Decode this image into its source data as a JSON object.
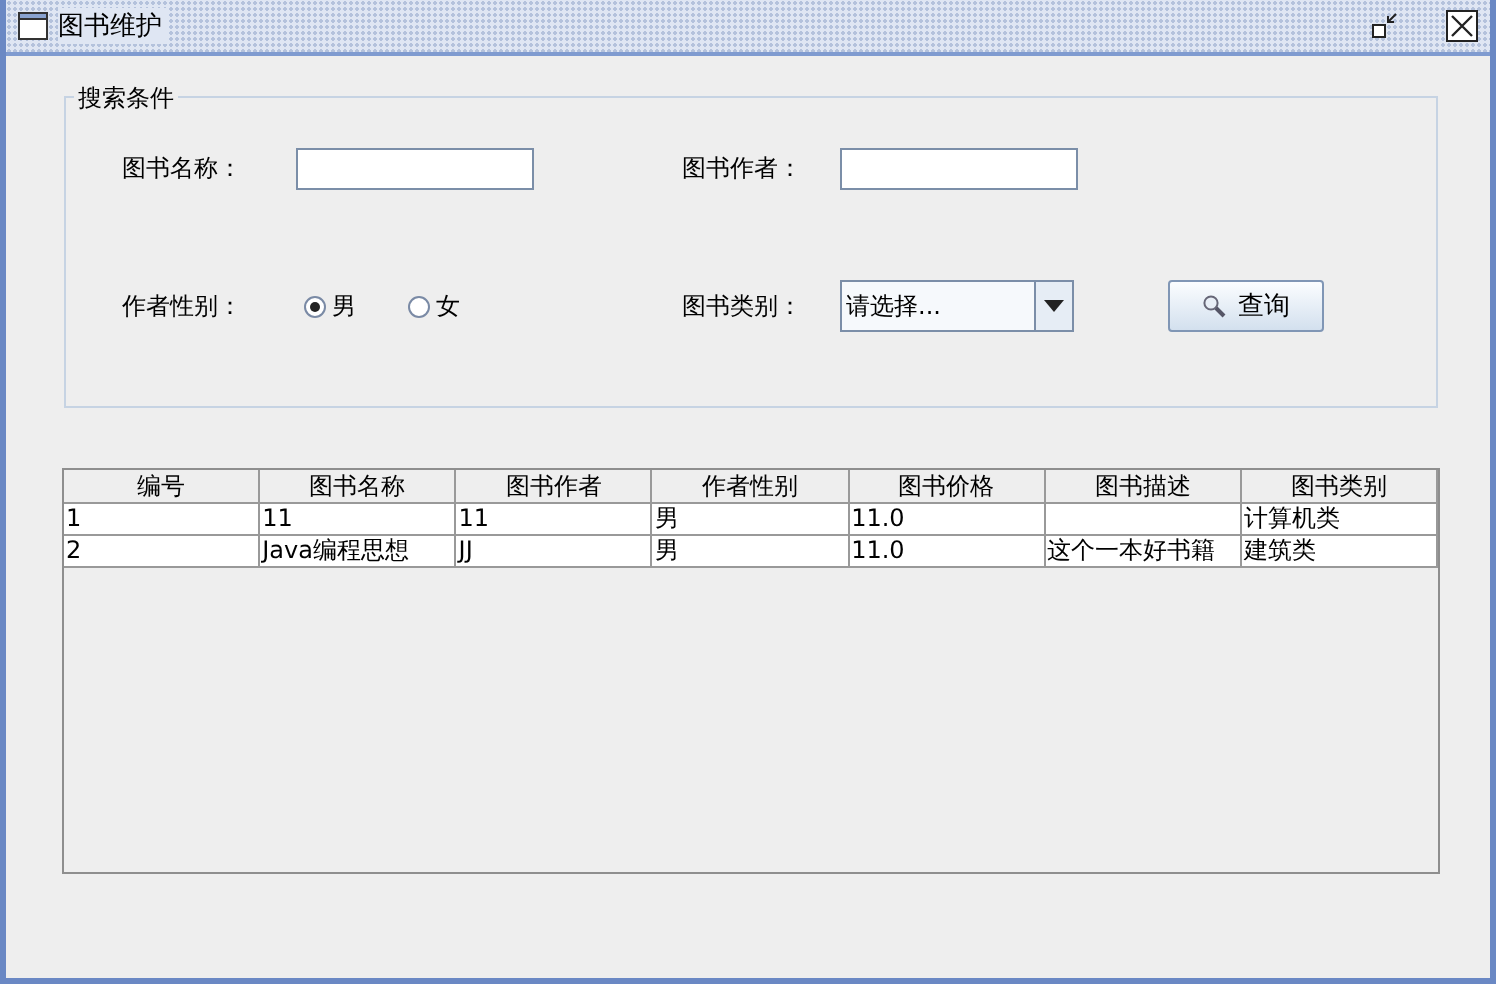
{
  "window": {
    "title": "图书维护"
  },
  "search": {
    "legend": "搜索条件",
    "name_field": {
      "label": "图书名称："
    },
    "author_field": {
      "label": "图书作者："
    },
    "gender": {
      "label": "作者性别：",
      "options": [
        {
          "label": "男",
          "selected": true
        },
        {
          "label": "女",
          "selected": false
        }
      ]
    },
    "category": {
      "label": "图书类别：",
      "value": "请选择..."
    },
    "button": {
      "label": "查询"
    }
  },
  "table": {
    "columns": [
      "编号",
      "图书名称",
      "图书作者",
      "作者性别",
      "图书价格",
      "图书描述",
      "图书类别"
    ],
    "rows": [
      [
        "1",
        "11",
        "11",
        "男",
        "11.0",
        null,
        "计算机类"
      ],
      [
        "2",
        "Java编程思想",
        "JJ",
        "男",
        "11.0",
        "这个一本好书籍",
        "建筑类"
      ]
    ]
  }
}
